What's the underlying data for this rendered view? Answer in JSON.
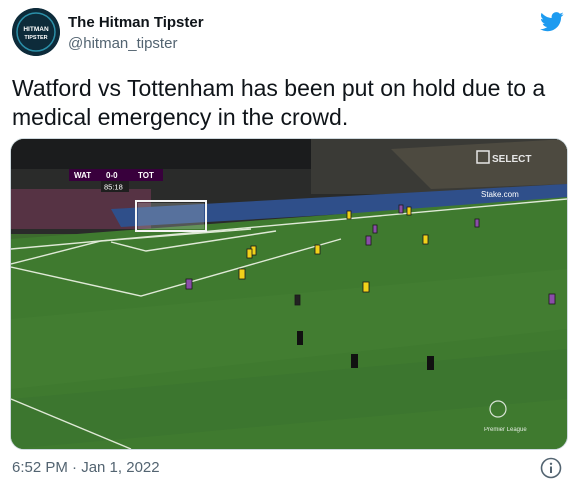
{
  "author": {
    "name": "The Hitman Tipster",
    "handle": "@hitman_tipster",
    "avatar_text": [
      "HITMAN",
      "TIPSTER"
    ]
  },
  "tweet": {
    "text": "Watford vs Tottenham has been put on hold due to a medical emergency in the crowd."
  },
  "media": {
    "scoreboard": {
      "home": "WAT",
      "score": "0-0",
      "away": "TOT",
      "clock": "85:18"
    },
    "broadcaster": "SELECT",
    "ad_board_text": "Stake.com",
    "league_text": "Premier League"
  },
  "footer": {
    "timestamp": "6:52 PM · Jan 1, 2022"
  },
  "icons": {
    "platform": "twitter-bird-icon",
    "info": "info-icon"
  },
  "colors": {
    "twitter_blue": "#1d9bf0",
    "pitch_green": "#3f7a2f",
    "watford_yellow": "#f2d21a",
    "tottenham_purple": "#8a4ea8"
  }
}
